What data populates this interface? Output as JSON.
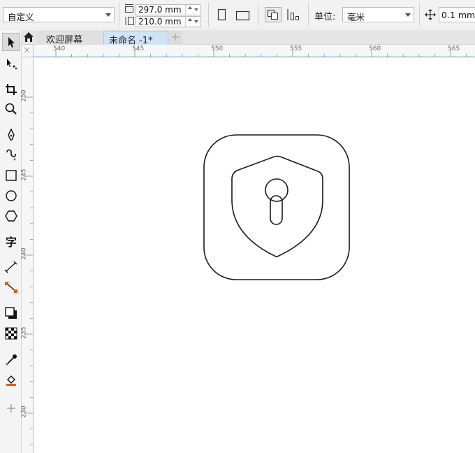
{
  "propbar": {
    "page_preset": "自定义",
    "page_width": "297.0 mm",
    "page_height": "210.0 mm",
    "units_label": "单位:",
    "units_value": "毫米",
    "nudge_value": "0.1 mm"
  },
  "tabs": [
    {
      "label": "欢迎屏幕",
      "active": false
    },
    {
      "label": "未命名 -1*",
      "active": true
    }
  ],
  "hruler": {
    "ticks": [
      "540",
      "545",
      "550",
      "555",
      "560",
      "565"
    ]
  },
  "vruler": {
    "ticks": [
      "250",
      "245",
      "240",
      "235",
      "230"
    ]
  },
  "colors": {
    "active_tab": "#cfe3f7",
    "stroke": "#1a1a1a",
    "accent_orange": "#e05a1c"
  }
}
